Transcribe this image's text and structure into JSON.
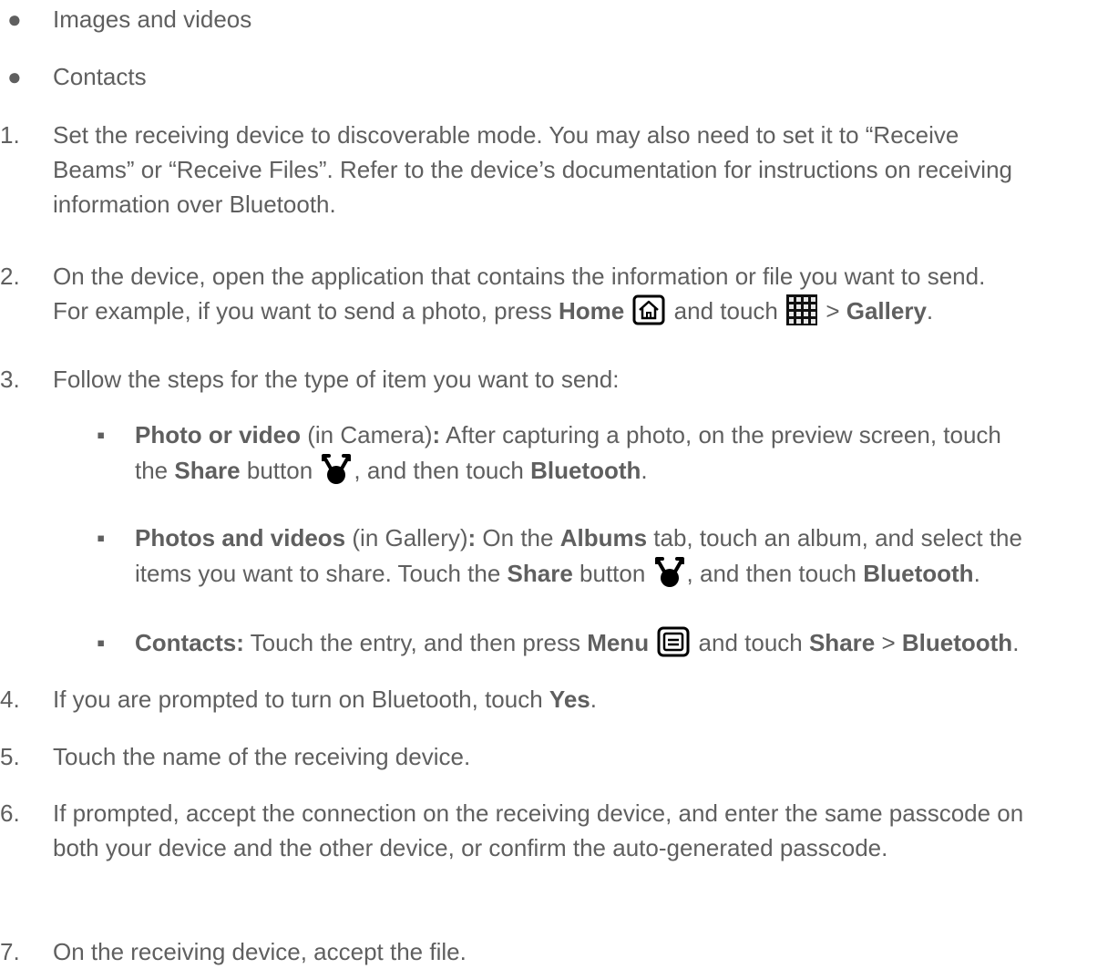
{
  "bullets": [
    {
      "marker": "●",
      "text": "Images and videos"
    },
    {
      "marker": "●",
      "text": "Contacts"
    }
  ],
  "steps": [
    {
      "num": "1.",
      "text": "Set the receiving device to discoverable mode. You may also need to set it to “Receive Beams” or “Receive Files”. Refer to the device’s documentation for instructions on receiving information over Bluetooth."
    },
    {
      "num": "2.",
      "line1": "On the device, open the application that contains the information or file you want to send.",
      "line2_pre": "For example, if you want to send a photo, press ",
      "home": "Home",
      "mid": " and touch ",
      "gt": " > ",
      "gallery": "Gallery",
      "end": "."
    },
    {
      "num": "3.",
      "text": "Follow the steps for the type of item you want to send:"
    },
    {
      "num": "4.",
      "pre": "If you are prompted to turn on Bluetooth, touch ",
      "yes": "Yes",
      "end": "."
    },
    {
      "num": "5.",
      "text": "Touch the name of the receiving device."
    },
    {
      "num": "6.",
      "text": "If prompted, accept the connection on the receiving device, and enter the same passcode on both your device and the other device, or confirm the auto-generated passcode."
    },
    {
      "num": "7.",
      "text": "On the receiving device, accept the file."
    }
  ],
  "substeps": [
    {
      "marker": "▪",
      "title": "Photo or video",
      "paren": " (in Camera)",
      "colon": ":",
      "line1_rest": " After capturing a photo, on the preview screen, touch",
      "line2_pre": "the ",
      "share": "Share",
      "button": " button ",
      "line2_mid": ", and then touch ",
      "bluetooth": "Bluetooth",
      "end": "."
    },
    {
      "marker": "▪",
      "title": "Photos and videos",
      "paren": " (in Gallery)",
      "colon": ":",
      "line1_mid": " On the ",
      "albums": "Albums",
      "line1_rest": " tab, touch an album, and select the",
      "line2_pre": "items you want to share. Touch the ",
      "share": "Share",
      "button": " button ",
      "line2_mid": ", and then touch ",
      "bluetooth": "Bluetooth",
      "end": "."
    },
    {
      "marker": "▪",
      "title": "Contacts:",
      "pre": " Touch the entry, and then press ",
      "menu": "Menu",
      "mid": " and touch ",
      "share": "Share",
      "gt": " > ",
      "bluetooth": "Bluetooth",
      "end": "."
    }
  ],
  "icons": {
    "home": "home-key-icon",
    "apps": "applications-grid-icon",
    "share": "share-icon",
    "menu": "menu-key-icon"
  }
}
